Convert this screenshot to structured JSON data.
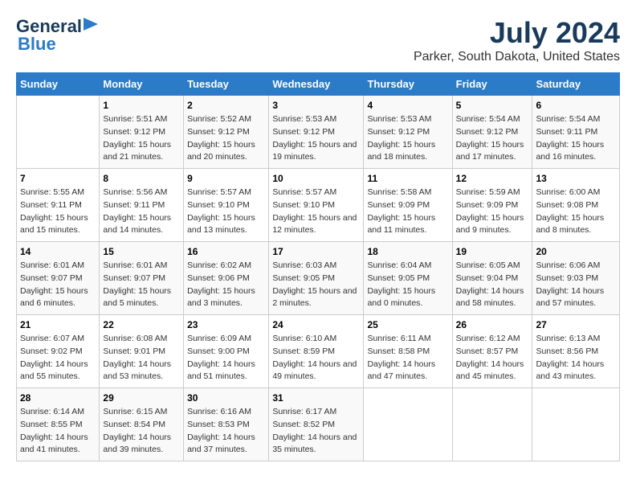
{
  "logo": {
    "general": "General",
    "blue": "Blue"
  },
  "title": "July 2024",
  "subtitle": "Parker, South Dakota, United States",
  "days_of_week": [
    "Sunday",
    "Monday",
    "Tuesday",
    "Wednesday",
    "Thursday",
    "Friday",
    "Saturday"
  ],
  "weeks": [
    [
      {
        "day": "",
        "sunrise": "",
        "sunset": "",
        "daylight": ""
      },
      {
        "day": "1",
        "sunrise": "Sunrise: 5:51 AM",
        "sunset": "Sunset: 9:12 PM",
        "daylight": "Daylight: 15 hours and 21 minutes."
      },
      {
        "day": "2",
        "sunrise": "Sunrise: 5:52 AM",
        "sunset": "Sunset: 9:12 PM",
        "daylight": "Daylight: 15 hours and 20 minutes."
      },
      {
        "day": "3",
        "sunrise": "Sunrise: 5:53 AM",
        "sunset": "Sunset: 9:12 PM",
        "daylight": "Daylight: 15 hours and 19 minutes."
      },
      {
        "day": "4",
        "sunrise": "Sunrise: 5:53 AM",
        "sunset": "Sunset: 9:12 PM",
        "daylight": "Daylight: 15 hours and 18 minutes."
      },
      {
        "day": "5",
        "sunrise": "Sunrise: 5:54 AM",
        "sunset": "Sunset: 9:12 PM",
        "daylight": "Daylight: 15 hours and 17 minutes."
      },
      {
        "day": "6",
        "sunrise": "Sunrise: 5:54 AM",
        "sunset": "Sunset: 9:11 PM",
        "daylight": "Daylight: 15 hours and 16 minutes."
      }
    ],
    [
      {
        "day": "7",
        "sunrise": "Sunrise: 5:55 AM",
        "sunset": "Sunset: 9:11 PM",
        "daylight": "Daylight: 15 hours and 15 minutes."
      },
      {
        "day": "8",
        "sunrise": "Sunrise: 5:56 AM",
        "sunset": "Sunset: 9:11 PM",
        "daylight": "Daylight: 15 hours and 14 minutes."
      },
      {
        "day": "9",
        "sunrise": "Sunrise: 5:57 AM",
        "sunset": "Sunset: 9:10 PM",
        "daylight": "Daylight: 15 hours and 13 minutes."
      },
      {
        "day": "10",
        "sunrise": "Sunrise: 5:57 AM",
        "sunset": "Sunset: 9:10 PM",
        "daylight": "Daylight: 15 hours and 12 minutes."
      },
      {
        "day": "11",
        "sunrise": "Sunrise: 5:58 AM",
        "sunset": "Sunset: 9:09 PM",
        "daylight": "Daylight: 15 hours and 11 minutes."
      },
      {
        "day": "12",
        "sunrise": "Sunrise: 5:59 AM",
        "sunset": "Sunset: 9:09 PM",
        "daylight": "Daylight: 15 hours and 9 minutes."
      },
      {
        "day": "13",
        "sunrise": "Sunrise: 6:00 AM",
        "sunset": "Sunset: 9:08 PM",
        "daylight": "Daylight: 15 hours and 8 minutes."
      }
    ],
    [
      {
        "day": "14",
        "sunrise": "Sunrise: 6:01 AM",
        "sunset": "Sunset: 9:07 PM",
        "daylight": "Daylight: 15 hours and 6 minutes."
      },
      {
        "day": "15",
        "sunrise": "Sunrise: 6:01 AM",
        "sunset": "Sunset: 9:07 PM",
        "daylight": "Daylight: 15 hours and 5 minutes."
      },
      {
        "day": "16",
        "sunrise": "Sunrise: 6:02 AM",
        "sunset": "Sunset: 9:06 PM",
        "daylight": "Daylight: 15 hours and 3 minutes."
      },
      {
        "day": "17",
        "sunrise": "Sunrise: 6:03 AM",
        "sunset": "Sunset: 9:05 PM",
        "daylight": "Daylight: 15 hours and 2 minutes."
      },
      {
        "day": "18",
        "sunrise": "Sunrise: 6:04 AM",
        "sunset": "Sunset: 9:05 PM",
        "daylight": "Daylight: 15 hours and 0 minutes."
      },
      {
        "day": "19",
        "sunrise": "Sunrise: 6:05 AM",
        "sunset": "Sunset: 9:04 PM",
        "daylight": "Daylight: 14 hours and 58 minutes."
      },
      {
        "day": "20",
        "sunrise": "Sunrise: 6:06 AM",
        "sunset": "Sunset: 9:03 PM",
        "daylight": "Daylight: 14 hours and 57 minutes."
      }
    ],
    [
      {
        "day": "21",
        "sunrise": "Sunrise: 6:07 AM",
        "sunset": "Sunset: 9:02 PM",
        "daylight": "Daylight: 14 hours and 55 minutes."
      },
      {
        "day": "22",
        "sunrise": "Sunrise: 6:08 AM",
        "sunset": "Sunset: 9:01 PM",
        "daylight": "Daylight: 14 hours and 53 minutes."
      },
      {
        "day": "23",
        "sunrise": "Sunrise: 6:09 AM",
        "sunset": "Sunset: 9:00 PM",
        "daylight": "Daylight: 14 hours and 51 minutes."
      },
      {
        "day": "24",
        "sunrise": "Sunrise: 6:10 AM",
        "sunset": "Sunset: 8:59 PM",
        "daylight": "Daylight: 14 hours and 49 minutes."
      },
      {
        "day": "25",
        "sunrise": "Sunrise: 6:11 AM",
        "sunset": "Sunset: 8:58 PM",
        "daylight": "Daylight: 14 hours and 47 minutes."
      },
      {
        "day": "26",
        "sunrise": "Sunrise: 6:12 AM",
        "sunset": "Sunset: 8:57 PM",
        "daylight": "Daylight: 14 hours and 45 minutes."
      },
      {
        "day": "27",
        "sunrise": "Sunrise: 6:13 AM",
        "sunset": "Sunset: 8:56 PM",
        "daylight": "Daylight: 14 hours and 43 minutes."
      }
    ],
    [
      {
        "day": "28",
        "sunrise": "Sunrise: 6:14 AM",
        "sunset": "Sunset: 8:55 PM",
        "daylight": "Daylight: 14 hours and 41 minutes."
      },
      {
        "day": "29",
        "sunrise": "Sunrise: 6:15 AM",
        "sunset": "Sunset: 8:54 PM",
        "daylight": "Daylight: 14 hours and 39 minutes."
      },
      {
        "day": "30",
        "sunrise": "Sunrise: 6:16 AM",
        "sunset": "Sunset: 8:53 PM",
        "daylight": "Daylight: 14 hours and 37 minutes."
      },
      {
        "day": "31",
        "sunrise": "Sunrise: 6:17 AM",
        "sunset": "Sunset: 8:52 PM",
        "daylight": "Daylight: 14 hours and 35 minutes."
      },
      {
        "day": "",
        "sunrise": "",
        "sunset": "",
        "daylight": ""
      },
      {
        "day": "",
        "sunrise": "",
        "sunset": "",
        "daylight": ""
      },
      {
        "day": "",
        "sunrise": "",
        "sunset": "",
        "daylight": ""
      }
    ]
  ]
}
